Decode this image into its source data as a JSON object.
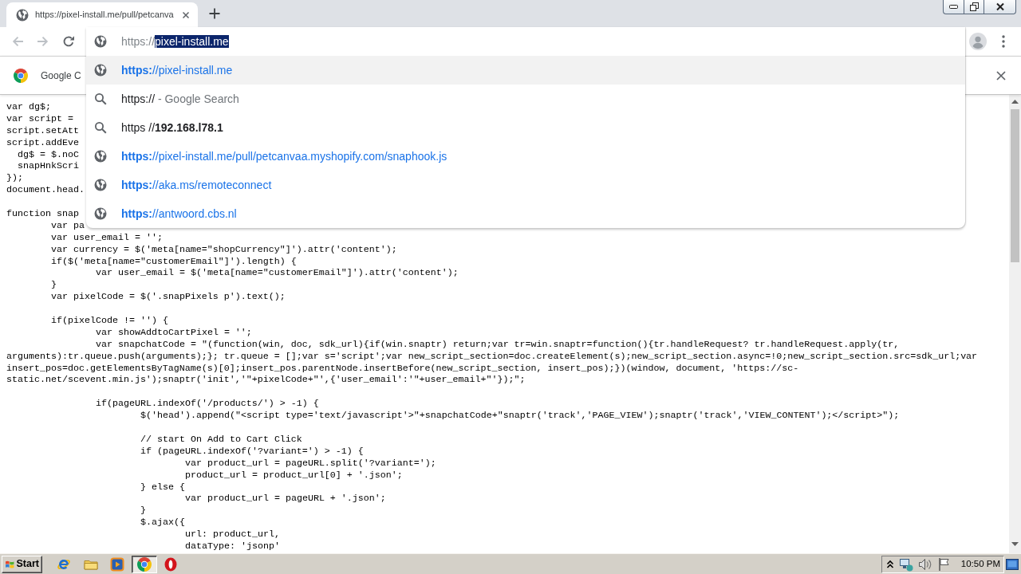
{
  "tabs": [
    {
      "title": "https://pixel-install.me/pull/petcanva",
      "selected": true
    }
  ],
  "nav_buttons": [
    {
      "kind": "back",
      "disabled": true
    },
    {
      "kind": "forward",
      "disabled": true
    },
    {
      "kind": "reload",
      "disabled": false
    }
  ],
  "omnibox": {
    "typed": "https://",
    "completion": "pixel-install.me"
  },
  "suggestions": [
    {
      "kind": "url",
      "text": "**https:**//pixel-install.me",
      "selected": true
    },
    {
      "kind": "search",
      "text": "https://",
      "suffix": "- Google Search",
      "selected": false
    },
    {
      "kind": "search",
      "text": "https //**192.168.l78.1**",
      "selected": false
    },
    {
      "kind": "url",
      "text": "**https:**//pixel-install.me/pull/petcanvaa.myshopify.com/snaphook.js",
      "selected": false
    },
    {
      "kind": "url",
      "text": "**https:**//aka.ms/remoteconnect",
      "selected": false
    },
    {
      "kind": "url",
      "text": "**https:**//antwoord.cbs.nl",
      "selected": false
    }
  ],
  "infobar": {
    "text": "Google C"
  },
  "code_blocks": [
    [
      "var dg$;",
      "var script =",
      "script.setAtt",
      "script.addEve",
      "  dg$ = $.noC",
      "  snapHnkScri",
      "});",
      "document.head."
    ],
    [
      "function snap",
      "        var pa",
      "        var user_email = '';",
      "        var currency = $('meta[name=\"shopCurrency\"]').attr('content');",
      "        if($('meta[name=\"customerEmail\"]').length) {",
      "                var user_email = $('meta[name=\"customerEmail\"]').attr('content');",
      "        }",
      "        var pixelCode = $('.snapPixels p').text();"
    ],
    [
      "        if(pixelCode != '') {",
      "                var showAddtoCartPixel = '';",
      "                var snapchatCode = \"(function(win, doc, sdk_url){if(win.snaptr) return;var tr=win.snaptr=function(){tr.handleRequest? tr.handleRequest.apply(tr,",
      "arguments):tr.queue.push(arguments);}; tr.queue = [];var s='script';var new_script_section=doc.createElement(s);new_script_section.async=!0;new_script_section.src=sdk_url;var",
      "insert_pos=doc.getElementsByTagName(s)[0];insert_pos.parentNode.insertBefore(new_script_section, insert_pos);})(window, document, 'https://sc-",
      "static.net/scevent.min.js');snaptr('init','\"+pixelCode+\"',{'user_email':'\"+user_email+\"'});\";"
    ],
    [
      "                if(pageURL.indexOf('/products/') > -1) {",
      "                        $('head').append(\"<script type='text/javascript'>\"+snapchatCode+\"snaptr('track','PAGE_VIEW');snaptr('track','VIEW_CONTENT');</script>\");"
    ],
    [
      "                        // start On Add to Cart Click",
      "                        if (pageURL.indexOf('?variant=') > -1) {",
      "                                var product_url = pageURL.split('?variant=');",
      "                                product_url = product_url[0] + '.json';",
      "                        } else {",
      "                                var product_url = pageURL + '.json';",
      "                        }",
      "                        $.ajax({",
      "                                url: product_url,",
      "                                dataType: 'jsonp'"
    ]
  ],
  "taskbar": {
    "start_label": "Start",
    "apps": [
      {
        "kind": "ie",
        "selected": false
      },
      {
        "kind": "folder",
        "selected": false
      },
      {
        "kind": "player",
        "selected": false
      },
      {
        "kind": "chrome",
        "selected": true
      },
      {
        "kind": "opera",
        "selected": false
      }
    ],
    "clock": "10:50 PM"
  }
}
